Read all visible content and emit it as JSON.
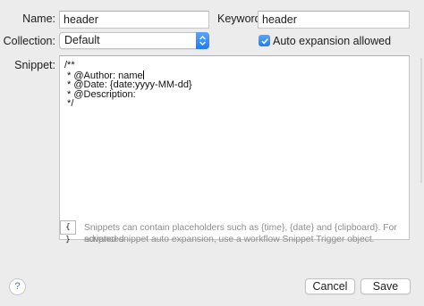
{
  "form": {
    "name_label": "Name:",
    "name_value": "header",
    "keyword_label": "Keyword:",
    "keyword_value": "header",
    "collection_label": "Collection:",
    "collection_value": "Default",
    "auto_expansion_label": "Auto expansion allowed",
    "auto_expansion_checked": true,
    "snippet_label": "Snippet:"
  },
  "snippet_lines": [
    "/**",
    " * @Author: name",
    " * @Date: {date:yyyy-MM-dd}",
    " * @Description:",
    " */"
  ],
  "footer": {
    "placeholder_button": "{ }",
    "hint_line1": "Snippets can contain placeholders such as {time}, {date} and {clipboard}. For advanced",
    "hint_line2": "scripted snippet auto expansion, use a workflow Snippet Trigger object.",
    "help_label": "?",
    "cancel_label": "Cancel",
    "save_label": "Save"
  },
  "colors": {
    "accent": "#1f7cf5",
    "window_bg": "#ececec",
    "hint_text": "#8d8d8d"
  }
}
